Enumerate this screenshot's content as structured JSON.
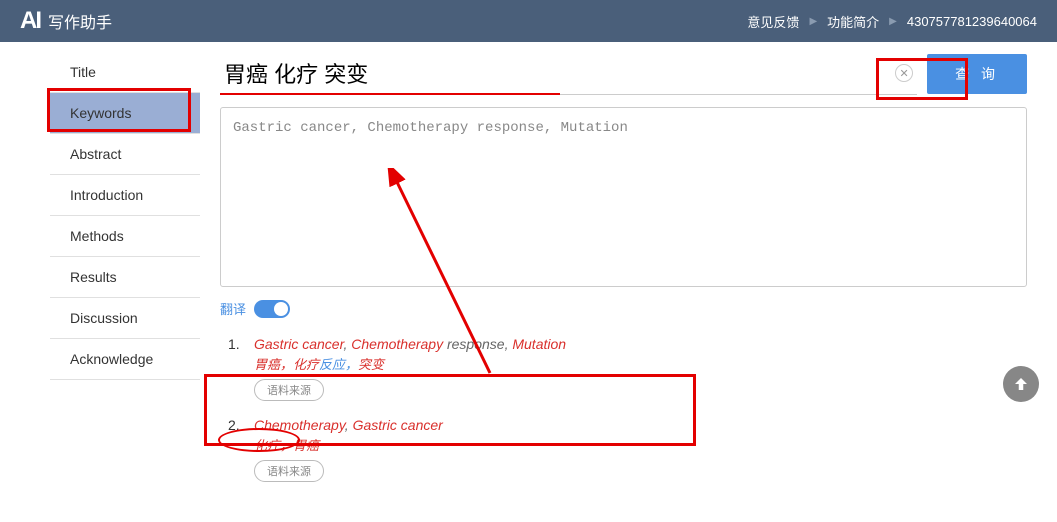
{
  "header": {
    "logo_icon": "AI",
    "logo_text": "写作助手",
    "feedback": "意见反馈",
    "features": "功能简介",
    "user_id": "430757781239640064"
  },
  "sidebar": {
    "items": [
      {
        "label": "Title"
      },
      {
        "label": "Keywords"
      },
      {
        "label": "Abstract"
      },
      {
        "label": "Introduction"
      },
      {
        "label": "Methods"
      },
      {
        "label": "Results"
      },
      {
        "label": "Discussion"
      },
      {
        "label": "Acknowledge"
      }
    ],
    "active_index": 1
  },
  "search": {
    "value": "胃癌 化疗 突变",
    "query_button": "查 询"
  },
  "result_box": "Gastric cancer, Chemotherapy response, Mutation",
  "translate": {
    "label": "翻译",
    "on": true
  },
  "results": [
    {
      "num": "1.",
      "en_parts": [
        {
          "t": "Gastric cancer",
          "hl": true
        },
        {
          "t": ", ",
          "hl": false
        },
        {
          "t": "Chemotherapy",
          "hl": true
        },
        {
          "t": " response, ",
          "hl": false
        },
        {
          "t": "Mutation",
          "hl": true
        }
      ],
      "cn_parts": [
        {
          "t": "胃癌，化疗",
          "hl": true
        },
        {
          "t": "反应，",
          "hl": false
        },
        {
          "t": "突变",
          "hl": true
        }
      ],
      "source_label": "语料来源"
    },
    {
      "num": "2.",
      "en_parts": [
        {
          "t": "Chemotherapy",
          "hl": true
        },
        {
          "t": ", ",
          "hl": false
        },
        {
          "t": "Gastric cancer",
          "hl": true
        }
      ],
      "cn_parts": [
        {
          "t": "化疗，胃癌",
          "hl": true
        }
      ],
      "source_label": "语料来源"
    }
  ]
}
